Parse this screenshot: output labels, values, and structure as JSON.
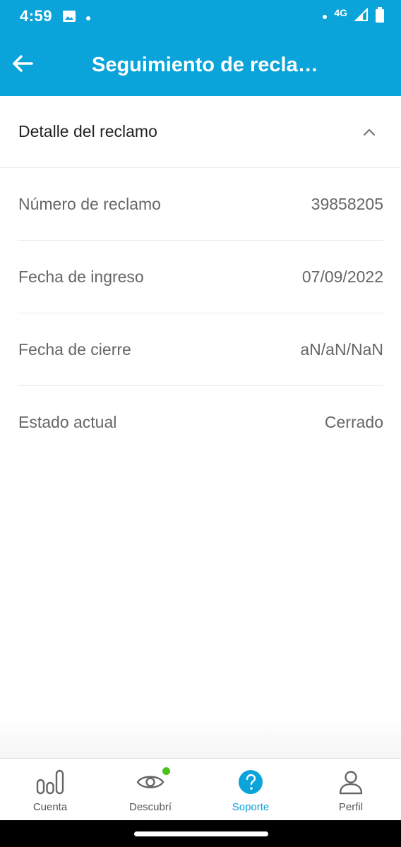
{
  "status_bar": {
    "time": "4:59",
    "network": "4G",
    "icons": [
      "image-icon",
      "notification-dot-icon",
      "signal-icon",
      "battery-icon"
    ]
  },
  "app_bar": {
    "title": "Seguimiento de recla…",
    "back_icon": "arrow-left-icon",
    "color": "#0aa3da"
  },
  "section": {
    "title": "Detalle del reclamo",
    "toggle_icon": "chevron-up-icon"
  },
  "details": [
    {
      "label": "Número de reclamo",
      "value": "39858205"
    },
    {
      "label": "Fecha de ingreso",
      "value": "07/09/2022"
    },
    {
      "label": "Fecha de cierre",
      "value": "aN/aN/NaN"
    },
    {
      "label": "Estado actual",
      "value": "Cerrado"
    }
  ],
  "bottom_nav": {
    "active_color": "#0aa3da",
    "items": [
      {
        "label": "Cuenta",
        "icon": "bar-chart-icon"
      },
      {
        "label": "Descubrí",
        "icon": "eye-icon",
        "badge_color": "#4cc21a"
      },
      {
        "label": "Soporte",
        "icon": "help-circle-icon",
        "active": true
      },
      {
        "label": "Perfil",
        "icon": "user-icon"
      }
    ]
  }
}
